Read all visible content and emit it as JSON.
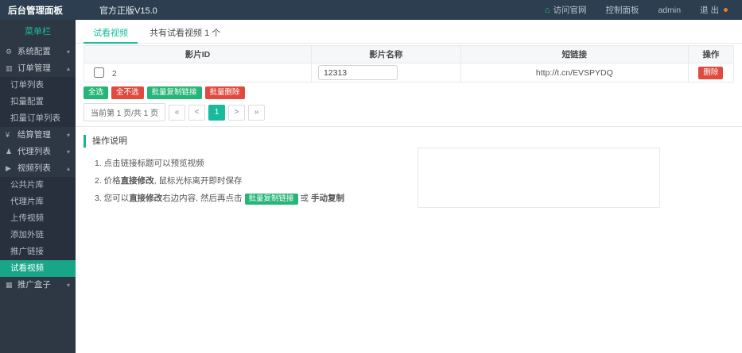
{
  "colors": {
    "accent_teal": "#18bc9c",
    "sidebar_active": "#18a689",
    "button_green": "#26b576",
    "button_red": "#e04b3f",
    "danger_red": "#e74c3c",
    "topbar_bg": "#2c3e50",
    "sidebar_bg": "#2e3744",
    "logout_dot": "#e67e22"
  },
  "topbar": {
    "brand": "后台管理面板",
    "version": "官方正版V15.0",
    "visit_site": "访问官网",
    "visit_site_glyph": "⌂",
    "control_panel": "控制面板",
    "username": "admin",
    "logout": "退 出"
  },
  "sidebar": {
    "header": "菜单栏",
    "chevron_collapsed": "▾",
    "chevron_expanded": "▴",
    "items": [
      {
        "label": "系统配置",
        "icon": "gear-icon",
        "glyph": "⚙"
      },
      {
        "label": "订单管理",
        "icon": "bar-chart-icon",
        "glyph": "▥"
      },
      {
        "label": "订单列表"
      },
      {
        "label": "扣量配置"
      },
      {
        "label": "扣量订单列表"
      },
      {
        "label": "结算管理",
        "icon": "yen-icon",
        "glyph": "¥"
      },
      {
        "label": "代理列表",
        "icon": "user-icon",
        "glyph": "♟"
      },
      {
        "label": "视频列表",
        "icon": "video-icon",
        "glyph": "▶"
      },
      {
        "label": "公共片库"
      },
      {
        "label": "代理片库"
      },
      {
        "label": "上传视频"
      },
      {
        "label": "添加外链"
      },
      {
        "label": "推广链接"
      },
      {
        "label": "试看视频"
      },
      {
        "label": "推广盒子",
        "icon": "box-icon",
        "glyph": "▦"
      }
    ]
  },
  "tabs": {
    "active": "试看视频",
    "summary": "共有试看视频 1 个"
  },
  "table": {
    "headers": [
      "影片ID",
      "影片名称",
      "短链接",
      "操作"
    ],
    "row": {
      "id": "2",
      "name": "12313",
      "link": "http://t.cn/EVSPYDQ",
      "action": "删除"
    }
  },
  "batch": {
    "select_all": "全选",
    "select_none": "全不选",
    "copy_links": "批量复制链接",
    "delete": "批量删除"
  },
  "pagination": {
    "summary": "当前第 1 页/共 1 页",
    "first": "«",
    "prev": "<",
    "page": "1",
    "next": ">",
    "last": "»"
  },
  "instructions": {
    "title": "操作说明",
    "step1": "1. 点击链接标题可以预览视频",
    "step2_pre": "2. 价格",
    "step2_bold": "直接修改",
    "step2_post": ", 鼠标光标离开即时保存",
    "step3_pre": "3. 您可以",
    "step3_bold": "直接修改",
    "step3_mid": "右边内容, 然后再点击",
    "step3_button": "批量复制链接",
    "step3_or": "或",
    "step3_bold2": "手动复制"
  }
}
